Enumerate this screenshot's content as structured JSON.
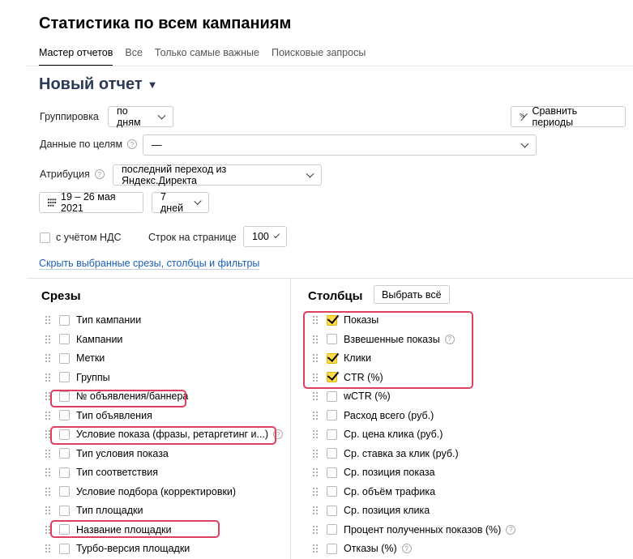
{
  "page_title": "Статистика по всем кампаниям",
  "tabs": [
    {
      "label": "Мастер отчетов",
      "active": true
    },
    {
      "label": "Все",
      "active": false
    },
    {
      "label": "Только самые важные",
      "active": false
    },
    {
      "label": "Поисковые запросы",
      "active": false
    }
  ],
  "report": {
    "title": "Новый отчет"
  },
  "filters": {
    "grouping_label": "Группировка",
    "grouping_value": "по дням",
    "compare_label": "Сравнить периоды",
    "goals_label": "Данные по целям",
    "goals_value": "—",
    "attribution_label": "Атрибуция",
    "attribution_value": "последний переход из Яндекс.Директа",
    "date_range": "19 – 26 мая 2021",
    "period_value": "7 дней",
    "vat_label": "с учётом НДС",
    "vat_checked": false,
    "rows_label": "Строк на странице",
    "rows_value": "100"
  },
  "toggle_link": "Скрыть выбранные срезы, столбцы и фильтры",
  "slices": {
    "title": "Срезы",
    "items": [
      {
        "label": "Тип кампании",
        "checked": false
      },
      {
        "label": "Кампании",
        "checked": false
      },
      {
        "label": "Метки",
        "checked": false
      },
      {
        "label": "Группы",
        "checked": false
      },
      {
        "label": "№ объявления/баннера",
        "checked": false
      },
      {
        "label": "Тип объявления",
        "checked": false
      },
      {
        "label": "Условие показа (фразы, ретаргетинг и...)",
        "checked": false,
        "help": true
      },
      {
        "label": "Тип условия показа",
        "checked": false
      },
      {
        "label": "Тип соответствия",
        "checked": false
      },
      {
        "label": "Условие подбора (корректировки)",
        "checked": false
      },
      {
        "label": "Тип площадки",
        "checked": false
      },
      {
        "label": "Название площадки",
        "checked": false
      },
      {
        "label": "Турбо-версия площадки",
        "checked": false
      }
    ]
  },
  "columns": {
    "title": "Столбцы",
    "select_all_label": "Выбрать всё",
    "items": [
      {
        "label": "Показы",
        "checked": true
      },
      {
        "label": "Взвешенные показы",
        "checked": false,
        "help": true
      },
      {
        "label": "Клики",
        "checked": true
      },
      {
        "label": "CTR (%)",
        "checked": true
      },
      {
        "label": "wCTR (%)",
        "checked": false
      },
      {
        "label": "Расход всего (руб.)",
        "checked": false
      },
      {
        "label": "Ср. цена клика (руб.)",
        "checked": false
      },
      {
        "label": "Ср. ставка за клик (руб.)",
        "checked": false
      },
      {
        "label": "Ср. позиция показа",
        "checked": false
      },
      {
        "label": "Ср. объём трафика",
        "checked": false
      },
      {
        "label": "Ср. позиция клика",
        "checked": false
      },
      {
        "label": "Процент полученных показов (%)",
        "checked": false,
        "help": true
      },
      {
        "label": "Отказы (%)",
        "checked": false,
        "help": true
      }
    ]
  },
  "colors": {
    "accent": "#ffdb4d",
    "highlight": "#e0405f",
    "link": "#1a5fb4",
    "title": "#2b3a56"
  }
}
